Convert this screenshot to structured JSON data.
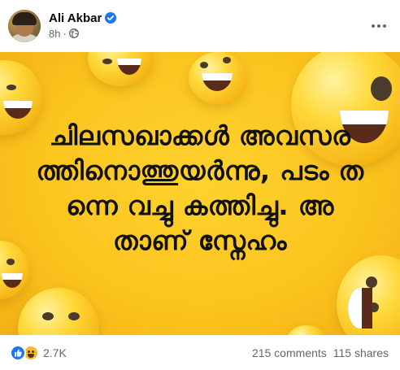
{
  "post": {
    "author": "Ali Akbar",
    "time": "8h",
    "separator": "·",
    "icons": {
      "verified": "verified-badge-icon",
      "audience": "globe-icon",
      "more": "more-options-icon"
    },
    "image_text": "ചിലസഖാക്കൾ അവസരത്തിനൊത്തുയർന്നു, പടം തന്നെ വച്ചു കത്തിച്ചു. അതാണ് സ്നേഹം",
    "reactions": {
      "types": [
        "like",
        "haha"
      ],
      "count": "2.7K"
    },
    "comments": "215 comments",
    "shares": "115 shares"
  },
  "colors": {
    "image_background": "#fcc51f",
    "accent_blue": "#1877f2",
    "secondary_text": "#65676b"
  }
}
